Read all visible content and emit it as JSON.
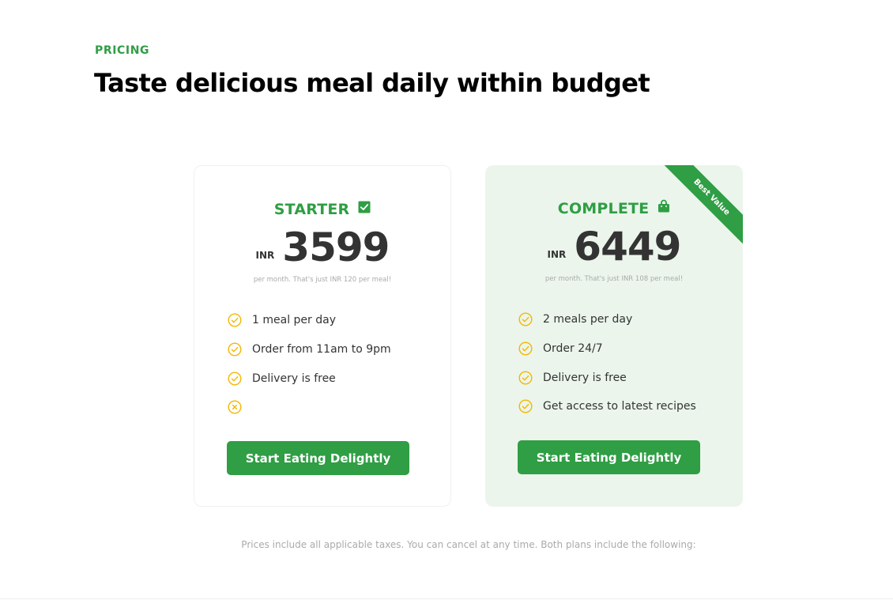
{
  "section": {
    "eyebrow": "PRICING",
    "heading": "Taste delicious meal daily within budget"
  },
  "colors": {
    "accent": "#2f9e44",
    "check": "#f5b700",
    "highlight_card_bg": "#ebf5ec"
  },
  "plans": [
    {
      "name": "STARTER",
      "icon": "checkbox-icon",
      "currency": "INR",
      "price": "3599",
      "per_meal": "per month. That's just INR 120 per meal!",
      "features": [
        {
          "icon": "check-circle-icon",
          "text": "1 meal per day"
        },
        {
          "icon": "check-circle-icon",
          "text": "Order from 11am to 9pm"
        },
        {
          "icon": "check-circle-icon",
          "text": "Delivery is free"
        },
        {
          "icon": "x-circle-icon",
          "text": ""
        }
      ],
      "cta_label": "Start Eating Delightly"
    },
    {
      "name": "COMPLETE",
      "icon": "shopping-bag-icon",
      "currency": "INR",
      "price": "6449",
      "per_meal": "per month. That's just INR 108 per meal!",
      "badge": "Best Value",
      "features": [
        {
          "icon": "check-circle-icon",
          "text": "2 meals per day"
        },
        {
          "icon": "check-circle-icon",
          "text": "Order 24/7"
        },
        {
          "icon": "check-circle-icon",
          "text": "Delivery is free"
        },
        {
          "icon": "check-circle-icon",
          "text": "Get access to latest recipes"
        }
      ],
      "cta_label": "Start Eating Delightly"
    }
  ],
  "footnote": "Prices include all applicable taxes. You can cancel at any time. Both plans include the following:"
}
